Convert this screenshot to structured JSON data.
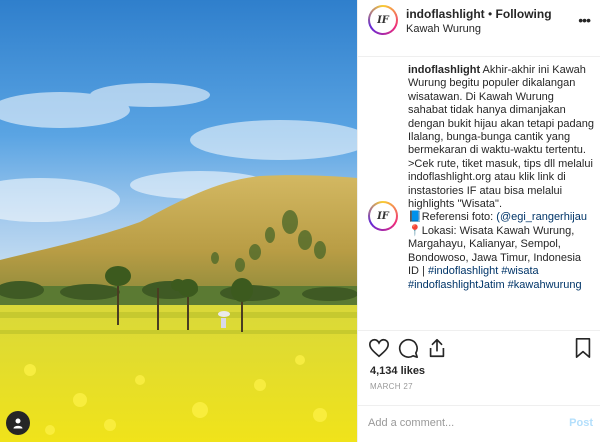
{
  "post": {
    "username": "indoflashlight",
    "separator": "•",
    "follow_status": "Following",
    "location": "Kawah Wurung",
    "avatar_text": "IF",
    "more_icon": "more-horizontal-icon"
  },
  "caption": {
    "username": "indoflashlight",
    "text": " Akhir-akhir ini Kawah Wurung begitu populer dikalangan wisatawan. Di Kawah Wurung sahabat tidak hanya dimanjakan dengan bukit hijau akan tetapi padang Ilalang, bunga-bunga cantik yang bermekaran di waktu-waktu tertentu.\n>Cek rute, tiket masuk, tips dll melalui indoflashlight.org atau klik link di instastories IF atau bisa melalui highlights \"Wisata\".",
    "referensi_label": "📘Referensi foto: ",
    "referensi_handle": "(@egi_rangerhijau",
    "lokasi": "\n📍Lokasi: Wisata Kawah Wurung, Margahayu, Kalianyar, Sempol, Bondowoso, Jawa Timur, Indonesia",
    "id_prefix": "\nID | ",
    "hashtags": "#indoflashlight #wisata #indoflashlightJatim #kawahwurung"
  },
  "actions": {
    "likes": "4,134 likes",
    "date": "MARCH 27",
    "comment_placeholder": "Add a comment...",
    "post_label": "Post",
    "icons": [
      "heart-icon",
      "comment-icon",
      "share-icon",
      "bookmark-icon"
    ]
  },
  "colors": {
    "sky": "#3d8fd6",
    "hill": "#c2a850",
    "flowers": "#e8e02a",
    "link": "#003569",
    "post_button": "#b3dffc"
  }
}
